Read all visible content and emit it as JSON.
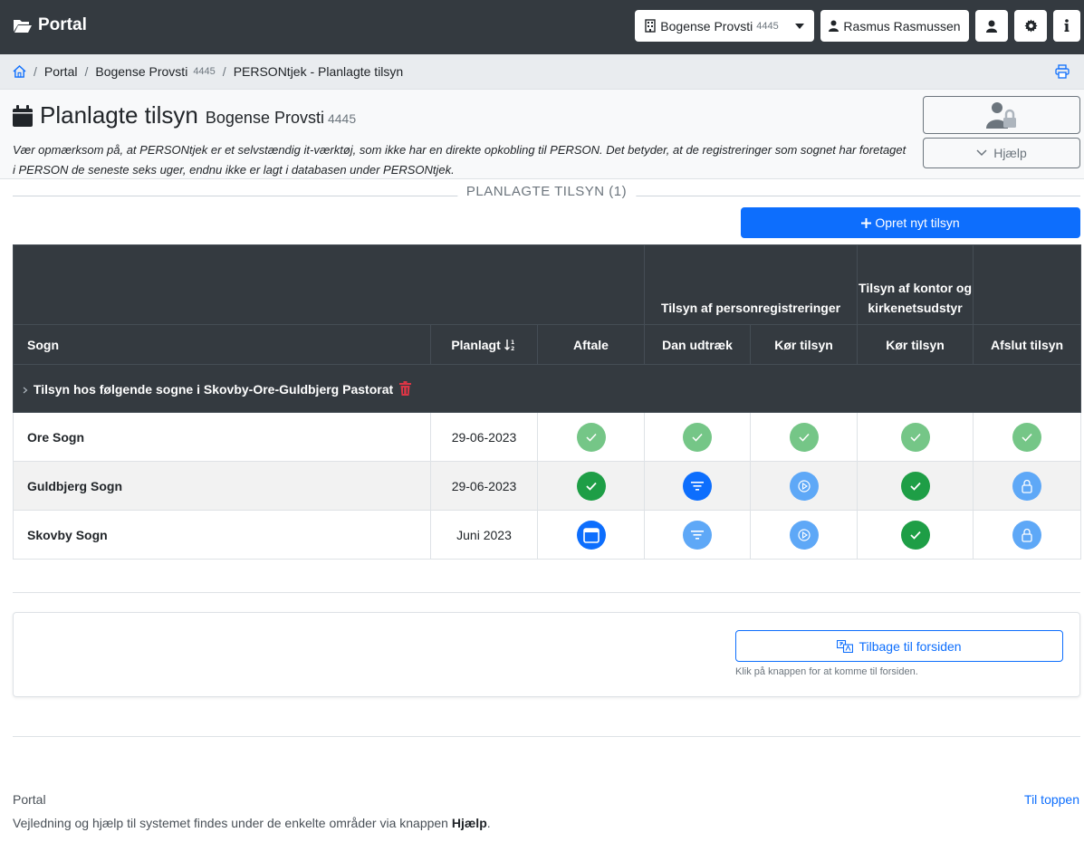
{
  "navbar": {
    "brand": "Portal",
    "provsti_name": "Bogense Provsti",
    "provsti_number": "4445",
    "user_name": "Rasmus Rasmussen"
  },
  "breadcrumb": {
    "home_icon": "home-icon",
    "portal": "Portal",
    "provsti_name": "Bogense Provsti",
    "provsti_number": "4445",
    "current": "PERSONtjek - Planlagte tilsyn"
  },
  "header": {
    "title": "Planlagte tilsyn",
    "subtitle_name": "Bogense Provsti",
    "subtitle_number": "4445",
    "notice": "Vær opmærksom på, at PERSONtjek er et selvstændig it-værktøj, som ikke har en direkte opkobling til PERSON. Det betyder, at de registreringer som sognet har foretaget i PERSON de seneste seks uger, endnu ikke er lagt i databasen under PERSONtjek.",
    "help_label": "Hjælp"
  },
  "section": {
    "label": "PLANLAGTE TILSYN (1)"
  },
  "create_button": "Opret nyt tilsyn",
  "table": {
    "group_headers": {
      "person": "Tilsyn af personregistreringer",
      "office": "Tilsyn af kontor og kirkenetsudstyr"
    },
    "columns": {
      "sogn": "Sogn",
      "planlagt": "Planlagt",
      "aftale": "Aftale",
      "dan_udtraek": "Dan udtræk",
      "koer_tilsyn_1": "Kør tilsyn",
      "koer_tilsyn_2": "Kør tilsyn",
      "afslut": "Afslut tilsyn"
    },
    "group_row": "Tilsyn hos følgende sogne i Skovby-Ore-Guldbjerg Pastorat",
    "rows": [
      {
        "sogn": "Ore Sogn",
        "planlagt": "29-06-2023"
      },
      {
        "sogn": "Guldbjerg Sogn",
        "planlagt": "29-06-2023"
      },
      {
        "sogn": "Skovby Sogn",
        "planlagt": "Juni 2023"
      }
    ]
  },
  "back": {
    "button": "Tilbage til forsiden",
    "help": "Klik på knappen for at komme til forsiden."
  },
  "footer": {
    "name": "Portal",
    "text": "Vejledning og hjælp til systemet findes under de enkelte områder via knappen",
    "text_bold": "Hjælp",
    "text_end": ".",
    "to_top": "Til toppen"
  },
  "colors": {
    "navbar": "#343a40",
    "primary": "#0d6efd",
    "done_light": "#75c687",
    "done": "#1e9e46",
    "action_light": "#5ea8f7",
    "delete": "#dc3545"
  }
}
